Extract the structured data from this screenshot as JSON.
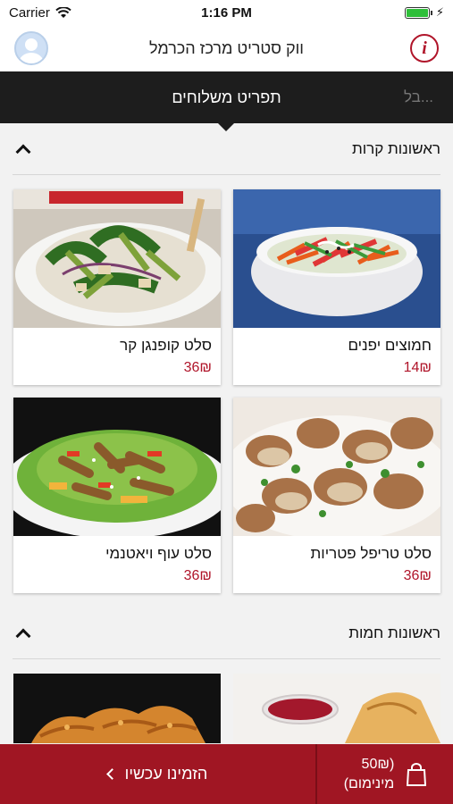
{
  "status_bar": {
    "carrier": "Carrier",
    "time": "1:16 PM"
  },
  "header": {
    "title": "ווק סטריט מרכז הכרמל"
  },
  "tabs": {
    "active": "תפריט משלוחים",
    "next": "בל..."
  },
  "sections": [
    {
      "title": "ראשונות קרות",
      "items": [
        {
          "name": "חמוצים יפנים",
          "price": "14₪",
          "image": "japanese-pickles"
        },
        {
          "name": "סלט קופנגן קר",
          "price": "36₪",
          "image": "koh-phangan-salad"
        },
        {
          "name": "סלט טריפל פטריות",
          "price": "36₪",
          "image": "triple-mushroom-salad"
        },
        {
          "name": "סלט עוף ויאטנמי",
          "price": "36₪",
          "image": "vietnamese-chicken-salad"
        }
      ]
    },
    {
      "title": "ראשונות חמות",
      "items": [
        {
          "name": "",
          "price": "",
          "image": "spring-roll-dip"
        },
        {
          "name": "",
          "price": "",
          "image": "fried-chicken-strips"
        }
      ]
    }
  ],
  "bottom_bar": {
    "order_label": "הזמינו עכשיו",
    "min_amount": "(50₪",
    "min_label": "מינימום)"
  },
  "colors": {
    "accent": "#a01623",
    "price": "#b0152a",
    "tabs_bg": "#1d1d1d"
  }
}
